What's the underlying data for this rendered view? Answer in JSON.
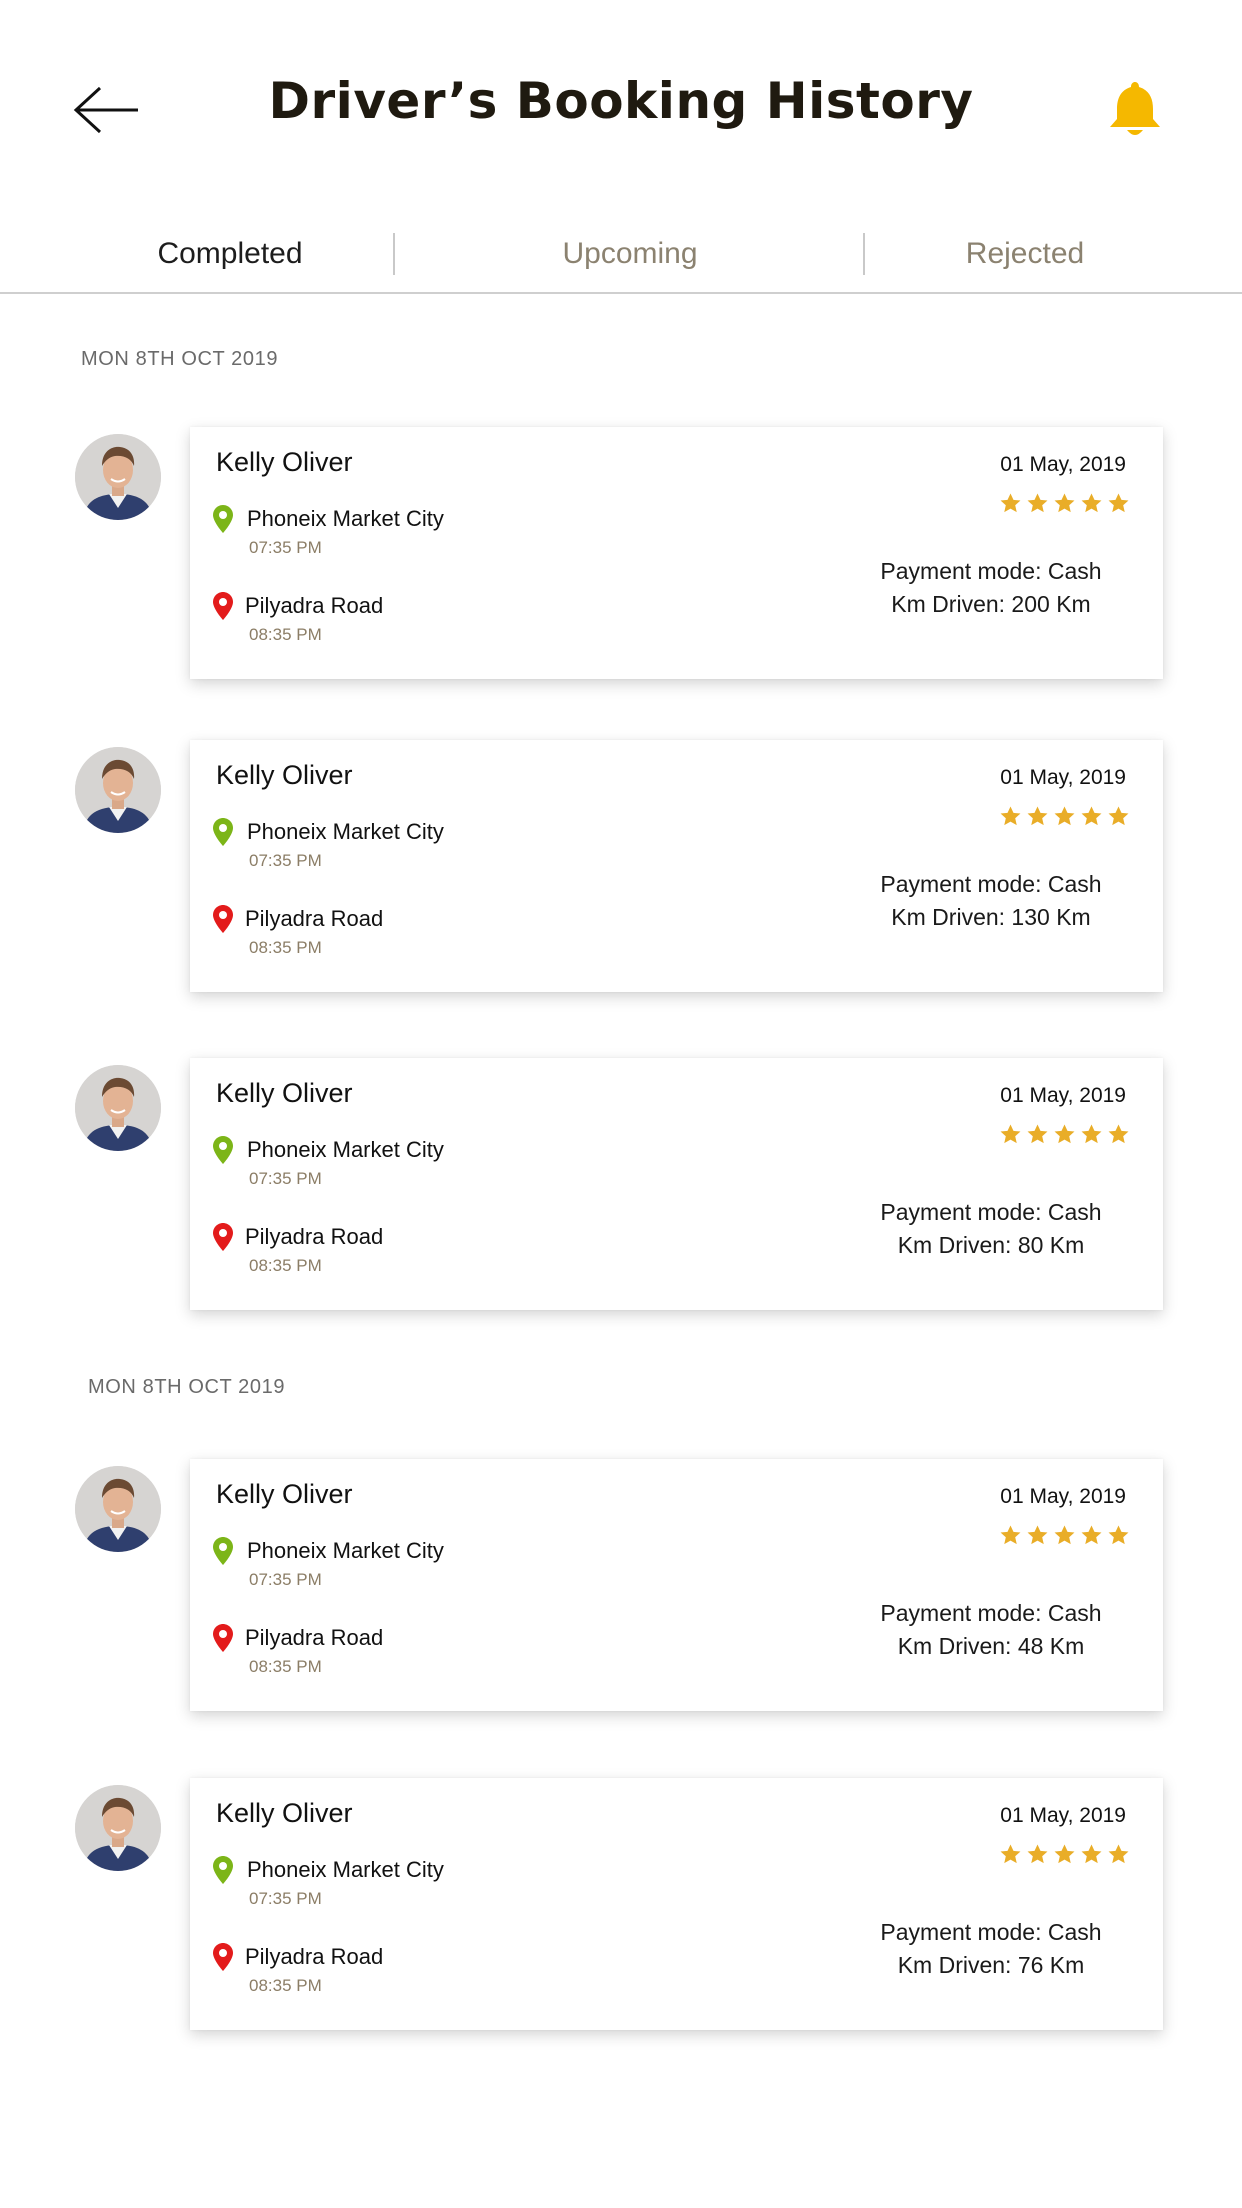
{
  "header": {
    "title": "Driver’s Booking History"
  },
  "tabs": [
    {
      "label": "Completed",
      "active": true
    },
    {
      "label": "Upcoming",
      "active": false
    },
    {
      "label": "Rejected",
      "active": false
    }
  ],
  "colors": {
    "accent": "#f5b800",
    "star": "#e9ad28",
    "pickup_pin": "#7cb518",
    "drop_pin": "#e31b1b"
  },
  "sections": [
    {
      "date": "MON 8TH OCT 2019",
      "bookings": [
        {
          "name": "Kelly Oliver",
          "pickup": "Phoneix Market City",
          "pickup_time": "07:35 PM",
          "drop": "Pilyadra Road",
          "drop_time": "08:35 PM",
          "date": "01 May, 2019",
          "rating": 5,
          "payment": "Payment mode: Cash",
          "km": "Km Driven: 200 Km"
        },
        {
          "name": "Kelly Oliver",
          "pickup": "Phoneix Market City",
          "pickup_time": "07:35 PM",
          "drop": "Pilyadra Road",
          "drop_time": "08:35 PM",
          "date": "01 May, 2019",
          "rating": 5,
          "payment": "Payment mode: Cash",
          "km": "Km Driven: 130 Km"
        },
        {
          "name": "Kelly Oliver",
          "pickup": "Phoneix Market City",
          "pickup_time": "07:35 PM",
          "drop": "Pilyadra Road",
          "drop_time": "08:35 PM",
          "date": "01 May, 2019",
          "rating": 5,
          "payment": "Payment mode: Cash",
          "km": "Km Driven: 80 Km"
        }
      ]
    },
    {
      "date": "MON 8TH OCT 2019",
      "bookings": [
        {
          "name": "Kelly Oliver",
          "pickup": "Phoneix Market City",
          "pickup_time": "07:35 PM",
          "drop": "Pilyadra Road",
          "drop_time": "08:35 PM",
          "date": "01 May, 2019",
          "rating": 5,
          "payment": "Payment mode: Cash",
          "km": "Km Driven: 48 Km"
        },
        {
          "name": "Kelly Oliver",
          "pickup": "Phoneix Market City",
          "pickup_time": "07:35 PM",
          "drop": "Pilyadra Road",
          "drop_time": "08:35 PM",
          "date": "01 May, 2019",
          "rating": 5,
          "payment": "Payment mode: Cash",
          "km": "Km Driven: 76 Km"
        }
      ]
    }
  ]
}
